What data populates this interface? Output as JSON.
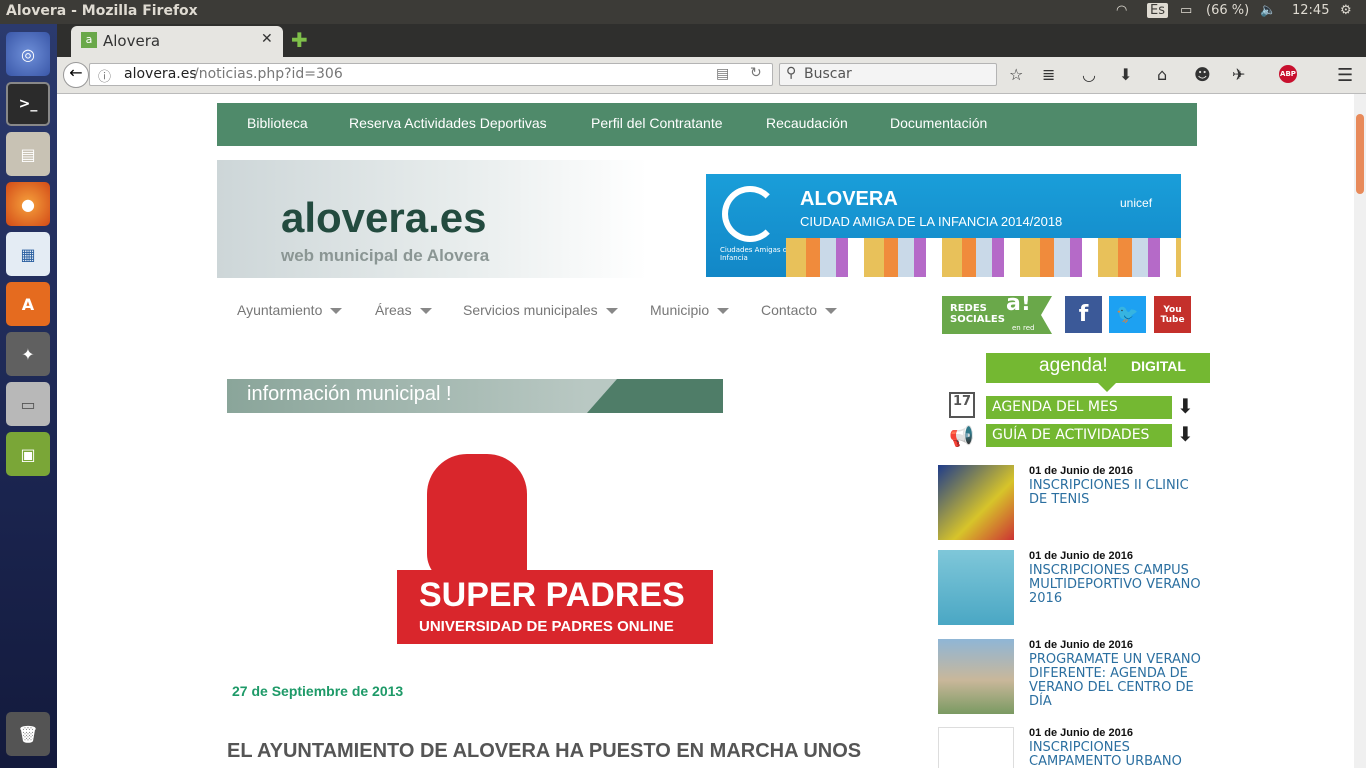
{
  "system": {
    "window_title": "Alovera - Mozilla Firefox",
    "keyboard": "Es",
    "battery": "(66 %)",
    "time": "12:45"
  },
  "browser": {
    "tab_title": "Alovera",
    "url_domain": "alovera.es",
    "url_path": "/noticias.php?id=306",
    "search_placeholder": "Buscar",
    "adblock_label": "ABP"
  },
  "site": {
    "top_nav": [
      "Biblioteca",
      "Reserva Actividades Deportivas",
      "Perfil del Contratante",
      "Recaudación",
      "Documentación"
    ],
    "logo_title": "alovera.es",
    "logo_subtitle": "web municipal de Alovera",
    "banner": {
      "title": "ALOVERA",
      "subtitle": "CIUDAD AMIGA DE LA INFANCIA 2014/2018",
      "logo_text": "Ciudades Amigas de la Infancia",
      "unicef": "unicef"
    },
    "main_nav": [
      "Ayuntamiento",
      "Áreas",
      "Servicios municipales",
      "Municipio",
      "Contacto"
    ],
    "section_header": "información municipal !",
    "article_image": {
      "title": "SUPER PADRES",
      "subtitle": "UNIVERSIDAD DE PADRES ONLINE"
    },
    "article_date": "27 de Septiembre de 2013",
    "article_headline": "EL AYUNTAMIENTO DE ALOVERA HA PUESTO EN MARCHA UNOS",
    "social": {
      "redes_line1": "REDES",
      "redes_line2": "SOCIALES",
      "redes_mark": "a!",
      "redes_sub": "en red",
      "facebook": "f",
      "youtube": "You Tube"
    },
    "agenda": {
      "title": "agenda!",
      "digital": "DIGITAL",
      "calendar_day": "17",
      "buttons": [
        "AGENDA DEL MES",
        "GUÍA DE ACTIVIDADES"
      ]
    },
    "news": [
      {
        "date": "01 de Junio de 2016",
        "title": "INSCRIPCIONES II CLINIC DE TENIS"
      },
      {
        "date": "01 de Junio de 2016",
        "title": "INSCRIPCIONES CAMPUS MULTIDEPORTIVO VERANO 2016"
      },
      {
        "date": "01 de Junio de 2016",
        "title": "PROGRAMATE UN VERANO DIFERENTE: AGENDA DE VERANO DEL CENTRO DE DÍA"
      },
      {
        "date": "01 de Junio de 2016",
        "title": "INSCRIPCIONES CAMPAMENTO URBANO"
      }
    ]
  }
}
